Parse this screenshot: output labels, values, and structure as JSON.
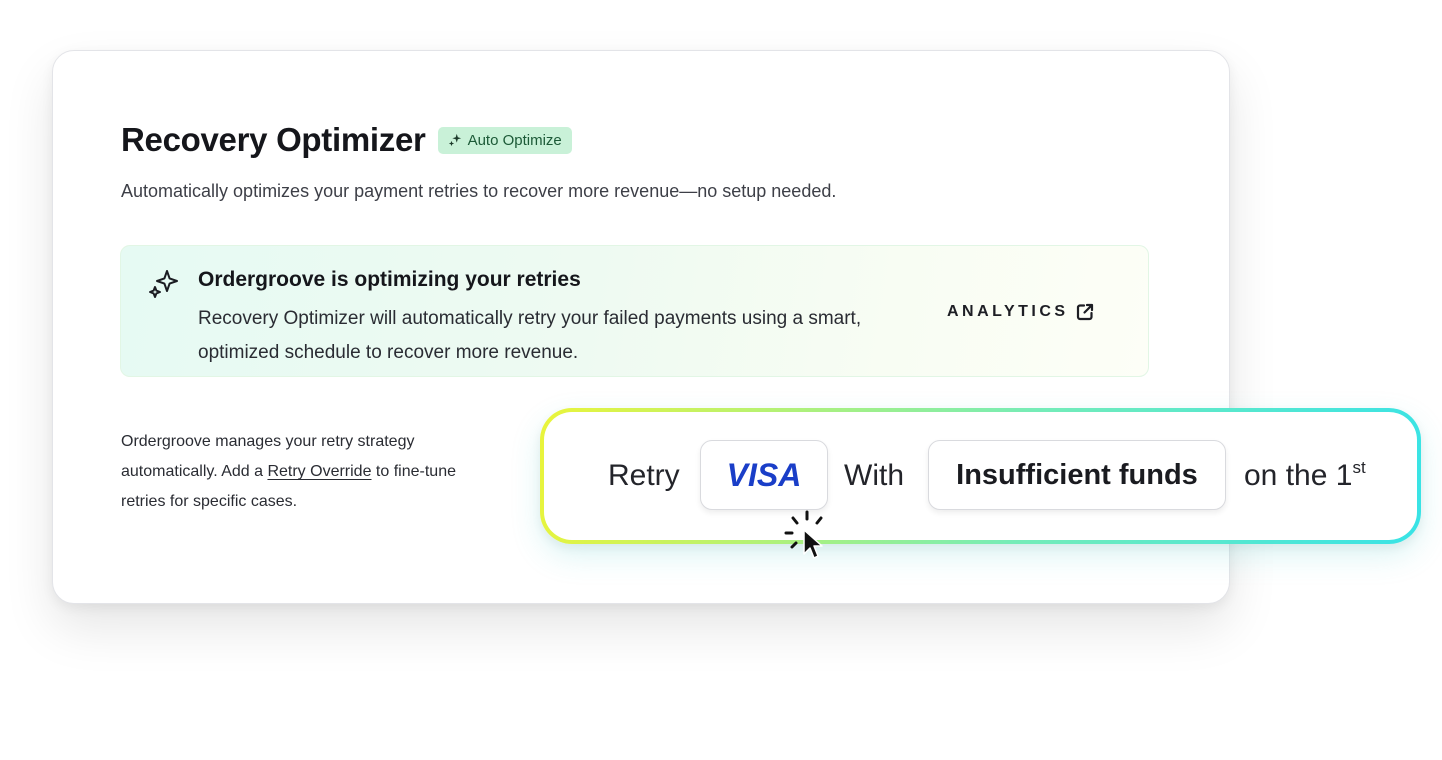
{
  "recovery": {
    "title": "Recovery Optimizer",
    "badge": "Auto Optimize",
    "subtitle": "Automatically optimizes your payment retries to recover more revenue—no setup needed."
  },
  "banner": {
    "icon": "sparkles-icon",
    "title": "Ordergroove is optimizing your retries",
    "body": "Recovery Optimizer will automatically retry your failed payments using a smart, optimized schedule to recover more revenue.",
    "action": "ANALYTICS",
    "action_icon": "external-link-icon"
  },
  "note": {
    "before": "Ordergroove manages your retry strategy automatically. Add a ",
    "link": "Retry Override",
    "after": " to fine-tune retries for specific cases."
  },
  "retry_rule": {
    "prefix": "Retry",
    "card": "VISA",
    "middle": "With",
    "reason": "Insufficient funds",
    "suffix": "on the 1",
    "suffix_sup": "st"
  },
  "colors": {
    "badge_bg": "#c9f1d8",
    "visa_blue": "#1a3ec8",
    "gradient_start": "#eaf43a",
    "gradient_end": "#38e3e6"
  }
}
